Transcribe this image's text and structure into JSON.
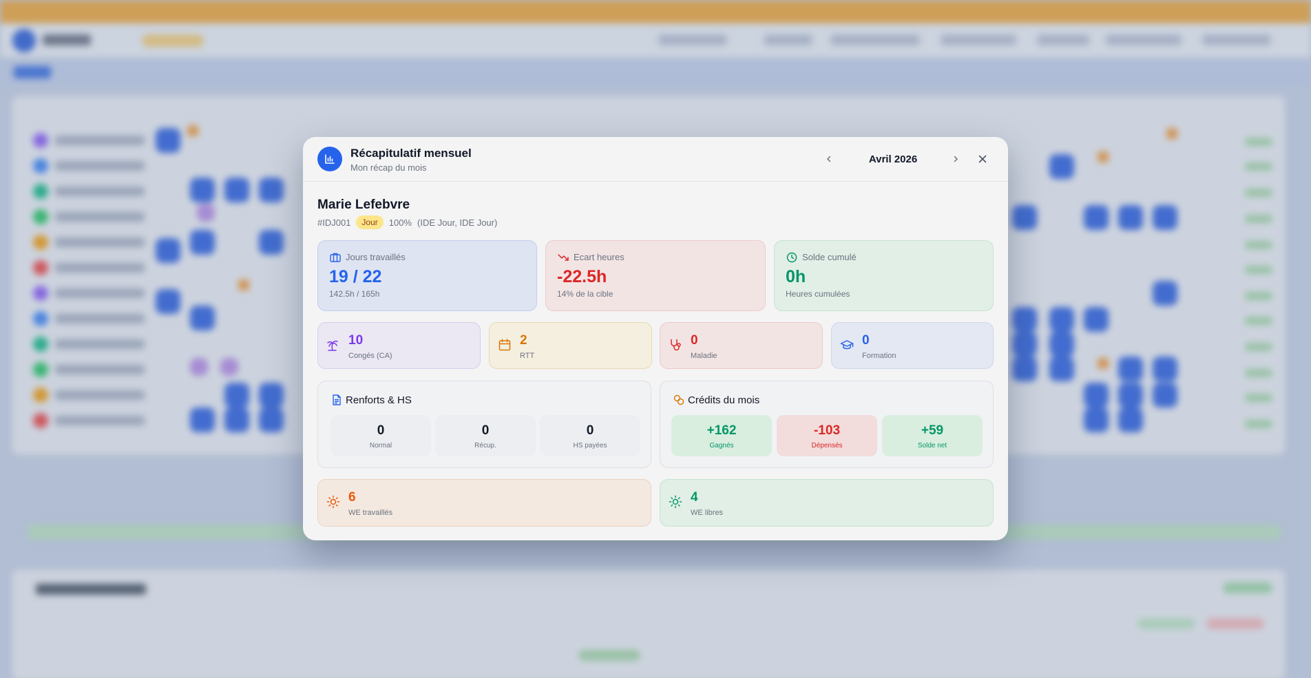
{
  "modal": {
    "title": "Récapitulatif mensuel",
    "subtitle": "Mon récap du mois",
    "month": "Avril 2026"
  },
  "employee": {
    "name": "Marie Lefebvre",
    "id": "#IDJ001",
    "shift": "Jour",
    "percent": "100%",
    "roles": "(IDE Jour, IDE Jour)"
  },
  "stats": {
    "worked_days": {
      "label": "Jours travaillés",
      "value": "19 / 22",
      "sub": "142.5h / 165h"
    },
    "hours_gap": {
      "label": "Ecart heures",
      "value": "-22.5h",
      "sub": "14% de la cible"
    },
    "balance": {
      "label": "Solde cumulé",
      "value": "0h",
      "sub": "Heures cumulées"
    }
  },
  "absences": [
    {
      "value": "10",
      "label": "Congés (CA)",
      "icon": "palm-tree-icon"
    },
    {
      "value": "2",
      "label": "RTT",
      "icon": "calendar-icon"
    },
    {
      "value": "0",
      "label": "Maladie",
      "icon": "stethoscope-icon"
    },
    {
      "value": "0",
      "label": "Formation",
      "icon": "graduation-cap-icon"
    }
  ],
  "reinforcements": {
    "title": "Renforts & HS",
    "items": [
      {
        "value": "0",
        "label": "Normal"
      },
      {
        "value": "0",
        "label": "Récup."
      },
      {
        "value": "0",
        "label": "HS payées"
      }
    ]
  },
  "credits": {
    "title": "Crédits du mois",
    "items": [
      {
        "value": "+162",
        "label": "Gagnés"
      },
      {
        "value": "-103",
        "label": "Dépensés"
      },
      {
        "value": "+59",
        "label": "Solde net"
      }
    ]
  },
  "weekends": {
    "worked": {
      "value": "6",
      "label": "WE travaillés"
    },
    "free": {
      "value": "4",
      "label": "WE libres"
    }
  },
  "colors": {
    "accent": "#2563eb",
    "negative": "#dc2626",
    "positive": "#059669",
    "purple": "#7c3aed",
    "amber": "#d97706",
    "orange": "#ea580c"
  }
}
